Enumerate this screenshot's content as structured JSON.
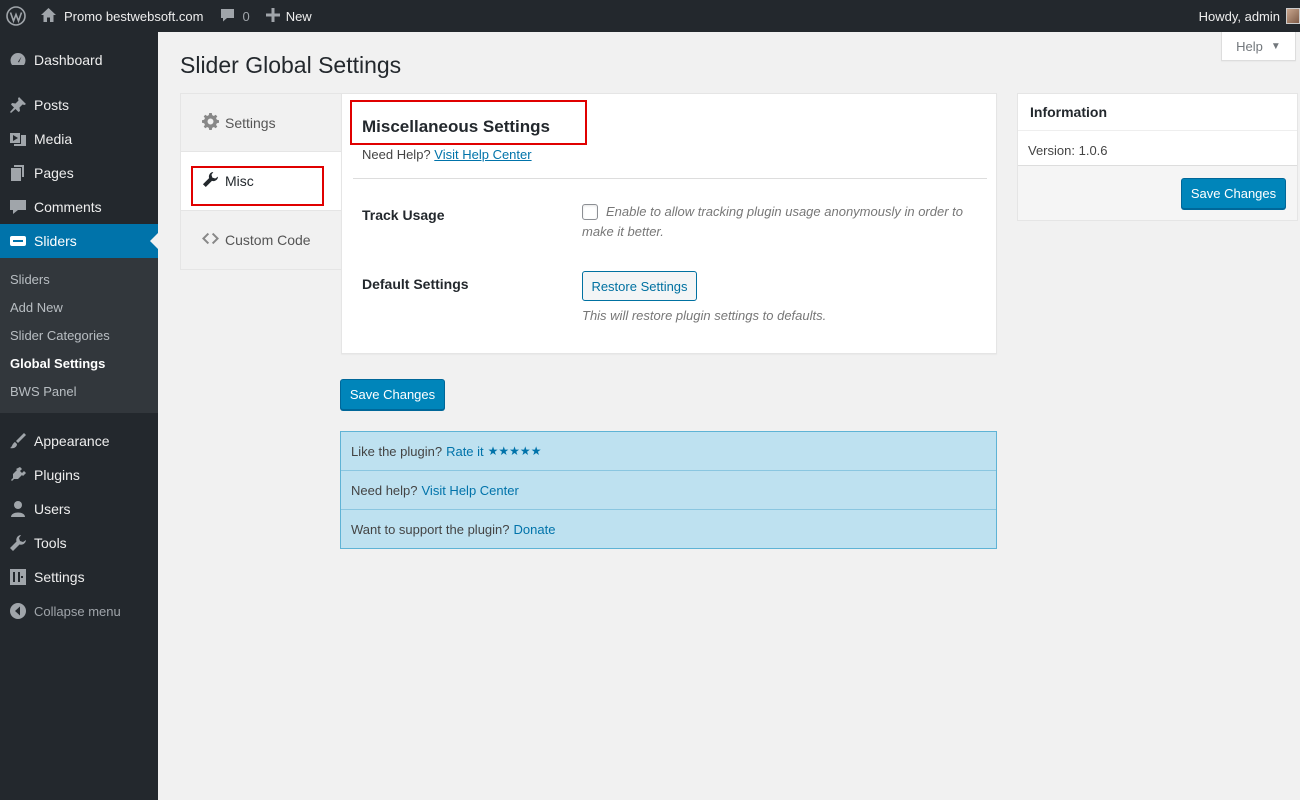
{
  "adminbar": {
    "site_name": "Promo bestwebsoft.com",
    "comments_count": "0",
    "new_label": "New",
    "howdy": "Howdy, admin"
  },
  "sidebar": {
    "items": [
      {
        "label": "Dashboard",
        "icon": "dashboard-icon"
      },
      {
        "label": "Posts",
        "icon": "pin-icon"
      },
      {
        "label": "Media",
        "icon": "media-icon"
      },
      {
        "label": "Pages",
        "icon": "pages-icon"
      },
      {
        "label": "Comments",
        "icon": "comment-icon"
      },
      {
        "label": "Sliders",
        "icon": "slider-icon"
      },
      {
        "label": "Appearance",
        "icon": "brush-icon"
      },
      {
        "label": "Plugins",
        "icon": "plug-icon"
      },
      {
        "label": "Users",
        "icon": "user-icon"
      },
      {
        "label": "Tools",
        "icon": "wrench-icon"
      },
      {
        "label": "Settings",
        "icon": "settings-icon"
      }
    ],
    "submenu": [
      "Sliders",
      "Add New",
      "Slider Categories",
      "Global Settings",
      "BWS Panel"
    ],
    "collapse_label": "Collapse menu"
  },
  "page": {
    "help_label": "Help",
    "title": "Slider Global Settings"
  },
  "tabs": [
    {
      "label": "Settings",
      "icon": "gear-icon"
    },
    {
      "label": "Misc",
      "icon": "wrench-icon"
    },
    {
      "label": "Custom Code",
      "icon": "code-icon"
    }
  ],
  "panel": {
    "title": "Miscellaneous Settings",
    "help_prefix": "Need Help?",
    "help_link": "Visit Help Center",
    "track_label": "Track Usage",
    "track_desc_line1": "Enable to allow tracking plugin usage anonymously in order to",
    "track_desc_line2": "make it better.",
    "default_label": "Default Settings",
    "restore_button": "Restore Settings",
    "restore_desc": "This will restore plugin settings to defaults."
  },
  "save_changes": "Save Changes",
  "info": {
    "title": "Information",
    "version_label": "Version:",
    "version_value": "1.0.6",
    "save_button": "Save Changes"
  },
  "notice": {
    "rate_prefix": "Like the plugin?",
    "rate_link": "Rate it",
    "stars": "★★★★★",
    "help_prefix": "Need help?",
    "help_link": "Visit Help Center",
    "donate_prefix": "Want to support the plugin?",
    "donate_link": "Donate"
  },
  "colors": {
    "accent": "#0073aa",
    "highlight": "#e00000",
    "sidebar_bg": "#23282d"
  }
}
